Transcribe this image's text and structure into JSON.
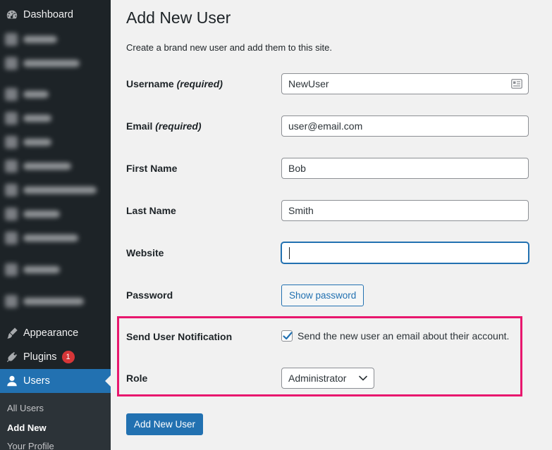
{
  "sidebar": {
    "dashboard_label": "Dashboard",
    "appearance_label": "Appearance",
    "plugins_label": "Plugins",
    "plugins_badge": "1",
    "users_label": "Users",
    "submenu": {
      "all_users": "All Users",
      "add_new": "Add New",
      "your_profile": "Your Profile"
    }
  },
  "main": {
    "title": "Add New User",
    "description": "Create a brand new user and add them to this site.",
    "form": {
      "username": {
        "label": "Username",
        "required": "(required)",
        "value": "NewUser"
      },
      "email": {
        "label": "Email",
        "required": "(required)",
        "value": "user@email.com"
      },
      "first_name": {
        "label": "First Name",
        "value": "Bob"
      },
      "last_name": {
        "label": "Last Name",
        "value": "Smith"
      },
      "website": {
        "label": "Website",
        "value": ""
      },
      "password": {
        "label": "Password",
        "button": "Show password"
      },
      "notification": {
        "label": "Send User Notification",
        "checkbox_label": "Send the new user an email about their account.",
        "checked": true
      },
      "role": {
        "label": "Role",
        "selected": "Administrator"
      }
    },
    "submit_label": "Add New User"
  },
  "colors": {
    "sidebar_bg": "#1d2327",
    "accent": "#2271b1",
    "highlight": "#e8176e",
    "badge": "#d63638"
  },
  "icons": {
    "dashboard": "dashboard-icon",
    "appearance": "paintbrush-icon",
    "plugins": "plugin-icon",
    "users": "user-icon",
    "contact": "contact-card-icon",
    "check": "checkmark-icon",
    "dropdown": "chevron-down-icon"
  }
}
